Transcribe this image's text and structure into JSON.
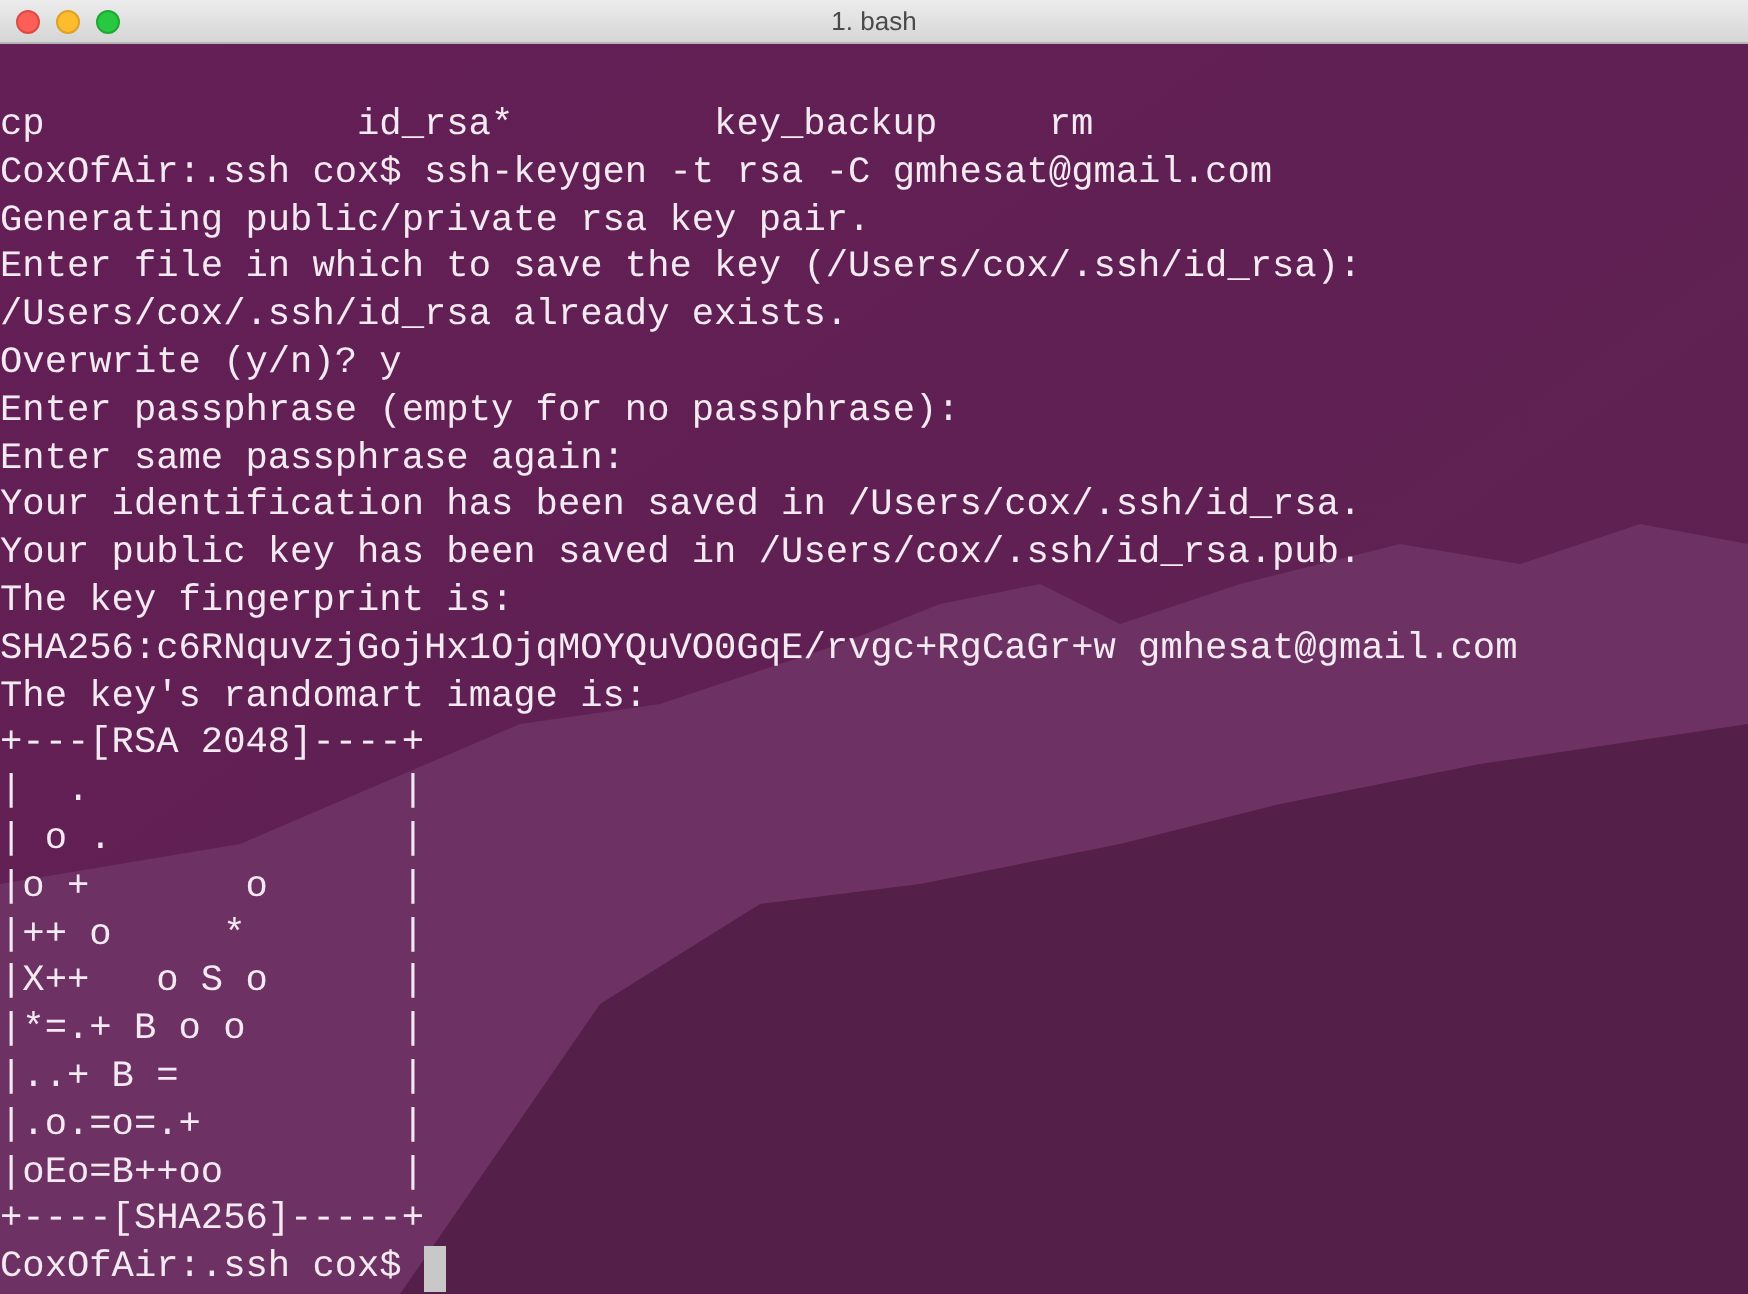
{
  "window": {
    "title": "1. bash"
  },
  "ls_listing": [
    "cp",
    "id_rsa*",
    "key_backup",
    "rm"
  ],
  "lines": [
    "CoxOfAir:.ssh cox$ ssh-keygen -t rsa -C gmhesat@gmail.com",
    "Generating public/private rsa key pair.",
    "Enter file in which to save the key (/Users/cox/.ssh/id_rsa):",
    "/Users/cox/.ssh/id_rsa already exists.",
    "Overwrite (y/n)? y",
    "Enter passphrase (empty for no passphrase):",
    "Enter same passphrase again:",
    "Your identification has been saved in /Users/cox/.ssh/id_rsa.",
    "Your public key has been saved in /Users/cox/.ssh/id_rsa.pub.",
    "The key fingerprint is:",
    "SHA256:c6RNquvzjGojHx1OjqMOYQuVO0GqE/rvgc+RgCaGr+w gmhesat@gmail.com",
    "The key's randomart image is:"
  ],
  "randomart": [
    "+---[RSA 2048]----+",
    "|  .              |",
    "| o .             |",
    "|o +       o      |",
    "|++ o     *       |",
    "|X++   o S o      |",
    "|*=.+ B o o       |",
    "|..+ B =          |",
    "|.o.=o=.+         |",
    "|oEo=B++oo        |",
    "+----[SHA256]-----+"
  ],
  "prompt": "CoxOfAir:.ssh cox$"
}
